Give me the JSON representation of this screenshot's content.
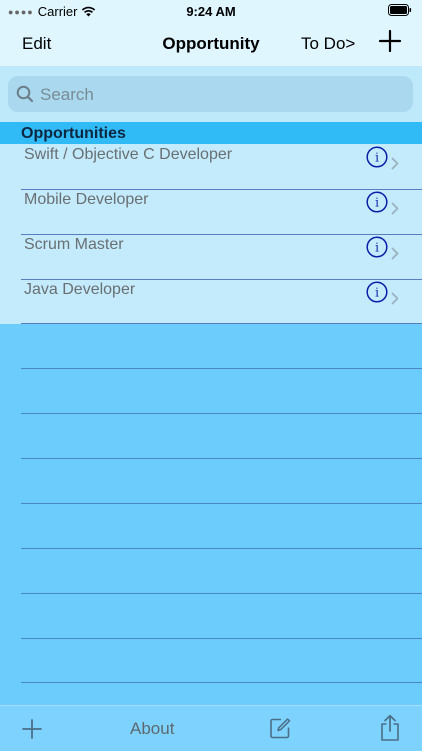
{
  "status_bar": {
    "carrier": "Carrier",
    "time": "9:24 AM"
  },
  "nav": {
    "edit": "Edit",
    "title": "Opportunity",
    "todo": "To Do>",
    "add_icon": "plus-icon"
  },
  "search": {
    "placeholder": "Search",
    "value": ""
  },
  "section": {
    "title": "Opportunities"
  },
  "rows": [
    {
      "label": "Swift / Objective C Developer"
    },
    {
      "label": "Mobile Developer"
    },
    {
      "label": "Scrum Master"
    },
    {
      "label": "Java Developer"
    }
  ],
  "toolbar": {
    "about": "About",
    "icons": [
      "plus-icon",
      "compose-icon",
      "share-icon"
    ]
  },
  "colors": {
    "accent": "#0a1fa8",
    "section": "#30bbf7",
    "list_bg": "#c3ebfc",
    "empty_bg": "#6ccdfd"
  }
}
